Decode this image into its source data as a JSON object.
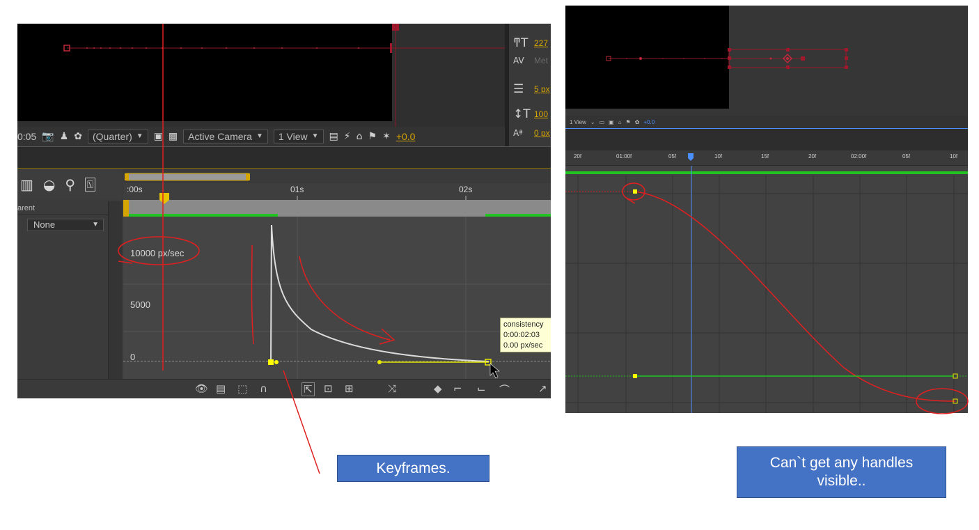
{
  "left": {
    "toolbar": {
      "timecode": "0:05",
      "resolution": "(Quarter)",
      "camera": "Active Camera",
      "view": "1 View",
      "exposure": "+0.0"
    },
    "char_panel": {
      "font_size": "227",
      "tracking": "Met",
      "stroke": "5 px",
      "vert_scale": "100",
      "baseline": "0 px"
    },
    "timeline": {
      "parent_header": "arent",
      "parent_value": "None",
      "ruler_ticks": [
        ":00s",
        "01s",
        "02s"
      ]
    },
    "graph": {
      "y_labels": [
        "10000 px/sec",
        "5000",
        "0"
      ]
    },
    "tooltip": {
      "line1": "consistency",
      "line2": "0:00:02:03",
      "line3": "0.00 px/sec"
    }
  },
  "right": {
    "toolbar": {
      "view": "1 View",
      "exposure": "+0.0"
    },
    "ruler_ticks": [
      "20f",
      "01:00f",
      "05f",
      "10f",
      "15f",
      "20f",
      "02:00f",
      "05f",
      "10f"
    ]
  },
  "annotations": {
    "keyframes_label": "Keyframes.",
    "handles_label": "Can`t get any handles visible.."
  },
  "colors": {
    "annotation_red": "#e02020",
    "callout_blue": "#4472c4",
    "keyframe_yellow": "#ffff00",
    "graph_green": "#22c322"
  }
}
